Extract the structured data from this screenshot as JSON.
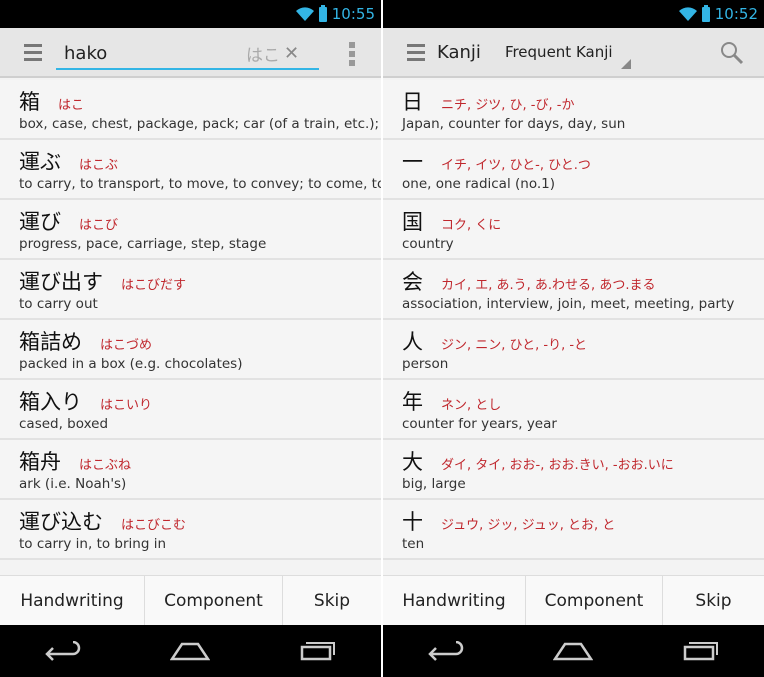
{
  "left": {
    "status": {
      "time": "10:55"
    },
    "search": {
      "value": "hako",
      "kana_hint": "はこ"
    },
    "results": [
      {
        "word": "箱",
        "reading": "はこ",
        "meaning": "box, case, chest, package, pack; car (of a train, etc.);"
      },
      {
        "word": "運ぶ",
        "reading": "はこぶ",
        "meaning": "to carry, to transport, to move, to convey; to come, to"
      },
      {
        "word": "運び",
        "reading": "はこび",
        "meaning": "progress, pace, carriage, step, stage"
      },
      {
        "word": "運び出す",
        "reading": "はこびだす",
        "meaning": "to carry out"
      },
      {
        "word": "箱詰め",
        "reading": "はこづめ",
        "meaning": "packed in a box (e.g. chocolates)"
      },
      {
        "word": "箱入り",
        "reading": "はこいり",
        "meaning": "cased, boxed"
      },
      {
        "word": "箱舟",
        "reading": "はこぶね",
        "meaning": "ark (i.e. Noah's)"
      },
      {
        "word": "運び込む",
        "reading": "はこびこむ",
        "meaning": "to carry in, to bring in"
      }
    ],
    "buttons": [
      "Handwriting",
      "Component",
      "Skip"
    ]
  },
  "right": {
    "status": {
      "time": "10:52"
    },
    "title": "Kanji",
    "spinner": "Frequent Kanji",
    "results": [
      {
        "word": "日",
        "reading": "ニチ, ジツ, ひ, -び, -か",
        "meaning": "Japan, counter for days, day, sun"
      },
      {
        "word": "一",
        "reading": "イチ, イツ, ひと-, ひと.つ",
        "meaning": "one, one radical (no.1)"
      },
      {
        "word": "国",
        "reading": "コク, くに",
        "meaning": "country"
      },
      {
        "word": "会",
        "reading": "カイ, エ, あ.う, あ.わせる, あつ.まる",
        "meaning": "association, interview, join, meet, meeting, party"
      },
      {
        "word": "人",
        "reading": "ジン, ニン, ひと, -り, -と",
        "meaning": "person"
      },
      {
        "word": "年",
        "reading": "ネン, とし",
        "meaning": "counter for years, year"
      },
      {
        "word": "大",
        "reading": "ダイ, タイ, おお-, おお.きい, -おお.いに",
        "meaning": "big, large"
      },
      {
        "word": "十",
        "reading": "ジュウ, ジッ, ジュッ, とお, と",
        "meaning": "ten"
      }
    ],
    "buttons": [
      "Handwriting",
      "Component",
      "Skip"
    ]
  },
  "colors": {
    "accent": "#33b5e5",
    "reading": "#c0272d"
  }
}
